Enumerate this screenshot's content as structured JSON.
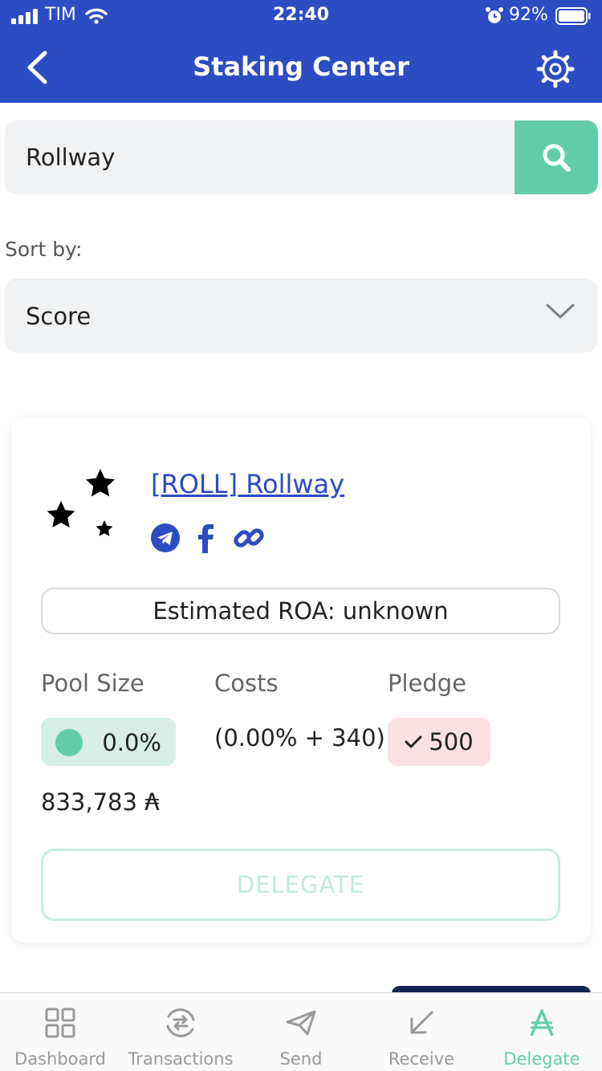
{
  "status_bar": {
    "carrier": "TIM",
    "time": "22:40",
    "battery": "92%"
  },
  "header": {
    "title": "Staking Center"
  },
  "search": {
    "value": "Rollway"
  },
  "sort": {
    "label": "Sort by:",
    "selected": "Score"
  },
  "pool": {
    "name": "[ROLL] Rollway",
    "estimated_roa": "Estimated ROA: unknown",
    "pool_size_label": "Pool Size",
    "costs_label": "Costs",
    "pledge_label": "Pledge",
    "pool_size_percent": "0.0%",
    "costs": "(0.00% + 340)",
    "pledge": "500",
    "pool_ada": "833,783 ₳",
    "delegate_label": "DELEGATE",
    "social_icons": [
      "telegram-icon",
      "facebook-icon",
      "link-icon"
    ]
  },
  "tabs": [
    {
      "label": "Dashboard",
      "icon": "dashboard-icon"
    },
    {
      "label": "Transactions",
      "icon": "transactions-icon"
    },
    {
      "label": "Send",
      "icon": "send-icon"
    },
    {
      "label": "Receive",
      "icon": "receive-icon"
    },
    {
      "label": "Delegate",
      "icon": "ada-icon"
    }
  ],
  "colors": {
    "brand_blue": "#2d4bc2",
    "accent_green": "#63cda9",
    "pool_size_bg": "#d6eee6",
    "pledge_bg": "#fbe0e4"
  }
}
